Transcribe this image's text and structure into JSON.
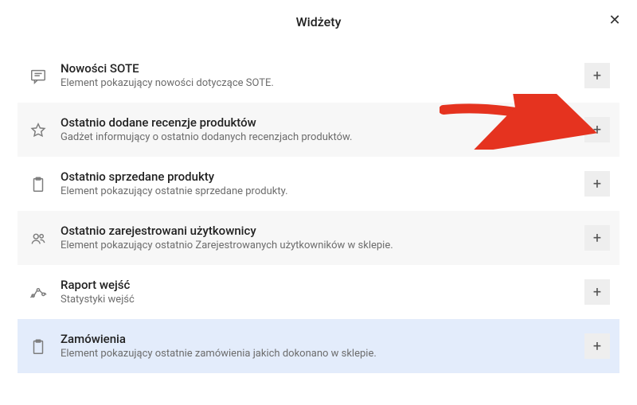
{
  "header": {
    "title": "Widżety",
    "close_glyph": "✕"
  },
  "add_glyph": "+",
  "widgets": [
    {
      "title": "Nowości SOTE",
      "desc": "Element pokazujący nowości dotyczące SOTE."
    },
    {
      "title": "Ostatnio dodane recenzje produktów",
      "desc": "Gadżet informujący o ostatnio dodanych recenzjach produktów."
    },
    {
      "title": "Ostatnio sprzedane produkty",
      "desc": "Element pokazujący ostatnie sprzedane produkty."
    },
    {
      "title": "Ostatnio zarejestrowani użytkownicy",
      "desc": "Element pokazujący ostatnio Zarejestrowanych użytkowników w sklepie."
    },
    {
      "title": "Raport wejść",
      "desc": "Statystyki wejść"
    },
    {
      "title": "Zamówienia",
      "desc": "Element pokazujący ostatnie zamówienia jakich dokonano w sklepie."
    }
  ]
}
